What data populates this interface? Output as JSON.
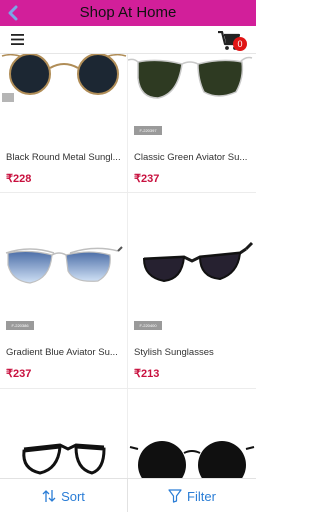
{
  "app": {
    "title": "Shop At Home"
  },
  "toolbar": {
    "cart_count": "0"
  },
  "products": [
    {
      "name": "Black Round Metal Sungl...",
      "price": "₹228",
      "sku": ""
    },
    {
      "name": "Classic Green Aviator Su...",
      "price": "₹237",
      "sku": "F-220397"
    },
    {
      "name": "Gradient Blue Aviator Su...",
      "price": "₹237",
      "sku": "F-220386"
    },
    {
      "name": "Stylish Sunglasses",
      "price": "₹213",
      "sku": "F-220400"
    }
  ],
  "bottom": {
    "sort_label": "Sort",
    "filter_label": "Filter"
  },
  "colors": {
    "appbar": "#d21f9a",
    "price": "#c8103e",
    "action": "#2a7dd6",
    "badge": "#e01414"
  },
  "icons": {
    "back": "chevron-left-icon",
    "menu": "hamburger-icon",
    "cart": "cart-icon",
    "sort": "sort-arrows-icon",
    "filter": "funnel-icon"
  }
}
